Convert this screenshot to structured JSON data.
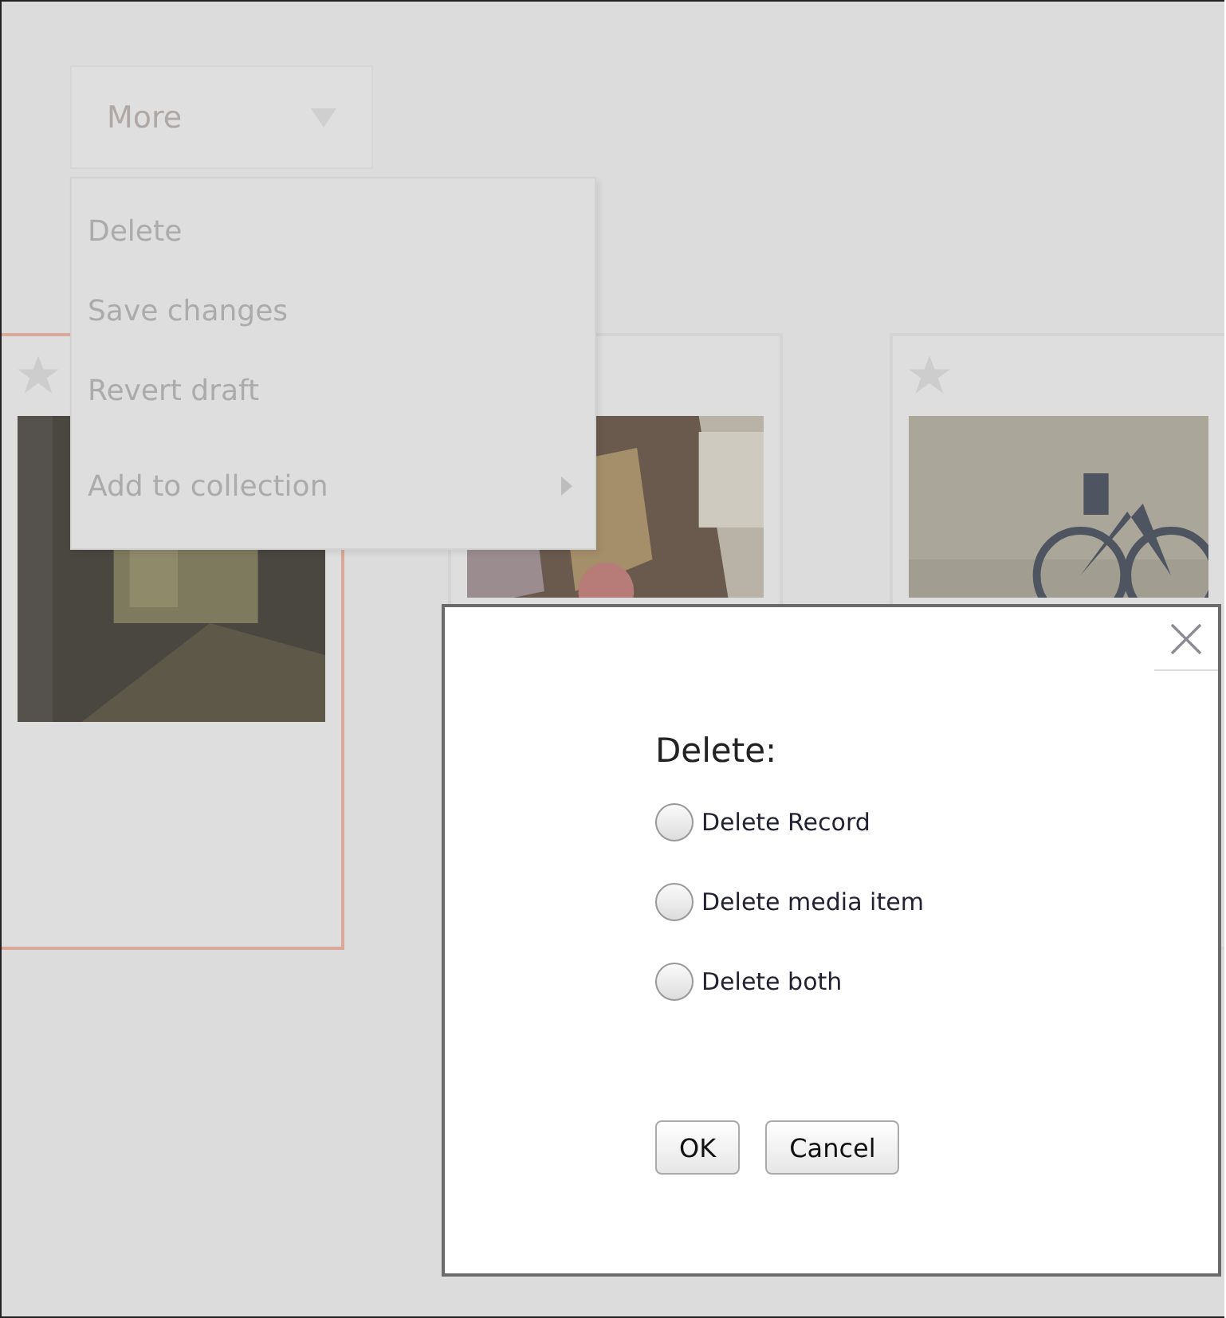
{
  "more_button": {
    "label": "More"
  },
  "menu": {
    "items": [
      {
        "label": "Delete",
        "kind": "action"
      },
      {
        "label": "Save changes",
        "kind": "action"
      },
      {
        "label": "Revert draft",
        "kind": "action"
      },
      {
        "label": "Add to collection",
        "kind": "submenu"
      }
    ]
  },
  "cards": [
    {
      "selected": true
    },
    {
      "selected": false
    },
    {
      "selected": false
    }
  ],
  "dialog": {
    "title": "Delete:",
    "options": [
      {
        "label": "Delete Record",
        "selected": false
      },
      {
        "label": "Delete media item",
        "selected": false
      },
      {
        "label": "Delete both",
        "selected": false
      }
    ],
    "buttons": [
      "OK",
      "Cancel"
    ]
  }
}
